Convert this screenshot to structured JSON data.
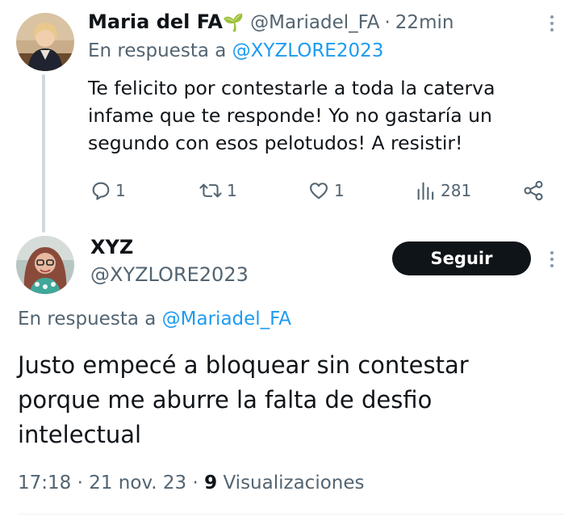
{
  "reply_tweet": {
    "author_name": "Maria del FA",
    "author_emoji": "🌱",
    "author_handle": "@Mariadel_FA",
    "time_sep": "·",
    "time": "22min",
    "reply_prefix": "En respuesta a",
    "reply_to": "@XYZLORE2023",
    "text_lines": [
      "Te felicito por contestarle a toda la caterva",
      "infame que te responde! Yo no gastaría un",
      "segundo con esos pelotudos! A resistir!"
    ],
    "metrics": {
      "replies": "1",
      "retweets": "1",
      "likes": "1",
      "views": "281"
    },
    "icons": [
      "reply-icon",
      "retweet-icon",
      "like-icon",
      "views-icon",
      "share-icon",
      "more-icon"
    ]
  },
  "main_tweet": {
    "author_name": "XYZ",
    "author_handle": "@XYZLORE2023",
    "follow_label": "Seguir",
    "reply_prefix": "En respuesta a",
    "reply_to": "@Mariadel_FA",
    "text_lines": [
      "Justo empecé a bloquear sin contestar",
      "porque me aburre la falta de desfio",
      "intelectual"
    ],
    "time": "17:18",
    "sep1": "·",
    "date": "21 nov. 23",
    "sep2": "·",
    "views_count": "9",
    "views_label": "Visualizaciones"
  },
  "colors": {
    "link": "#1d9bf0",
    "muted": "#536471",
    "text": "#0f1419",
    "button_bg": "#0f1419"
  }
}
